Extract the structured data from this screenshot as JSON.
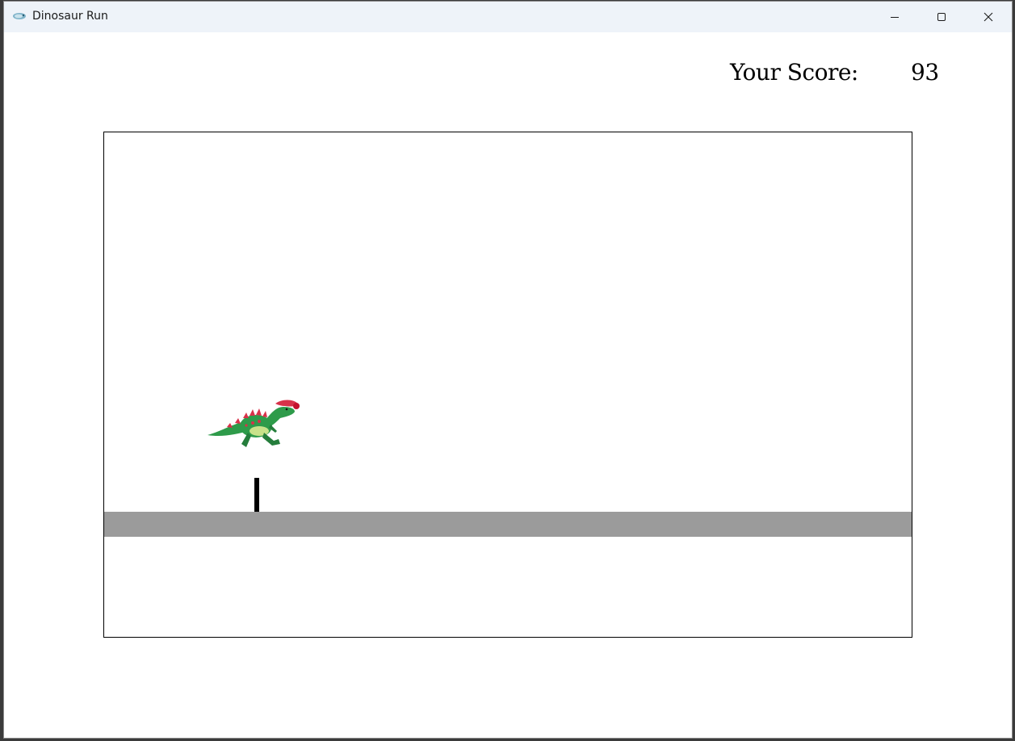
{
  "window": {
    "title": "Dinosaur Run",
    "app_icon": "dinosaur-app-icon",
    "controls": {
      "minimize_icon": "minimize-icon",
      "maximize_icon": "maximize-icon",
      "close_icon": "close-icon"
    }
  },
  "score": {
    "label": "Your Score:",
    "value": "93"
  },
  "game": {
    "player_sprite": "dinosaur-sprite",
    "obstacle": "post-obstacle",
    "colors": {
      "ground": "#9b9b9b",
      "obstacle": "#000000",
      "dino_body": "#2e9b4a",
      "dino_spikes": "#d8324a"
    }
  }
}
